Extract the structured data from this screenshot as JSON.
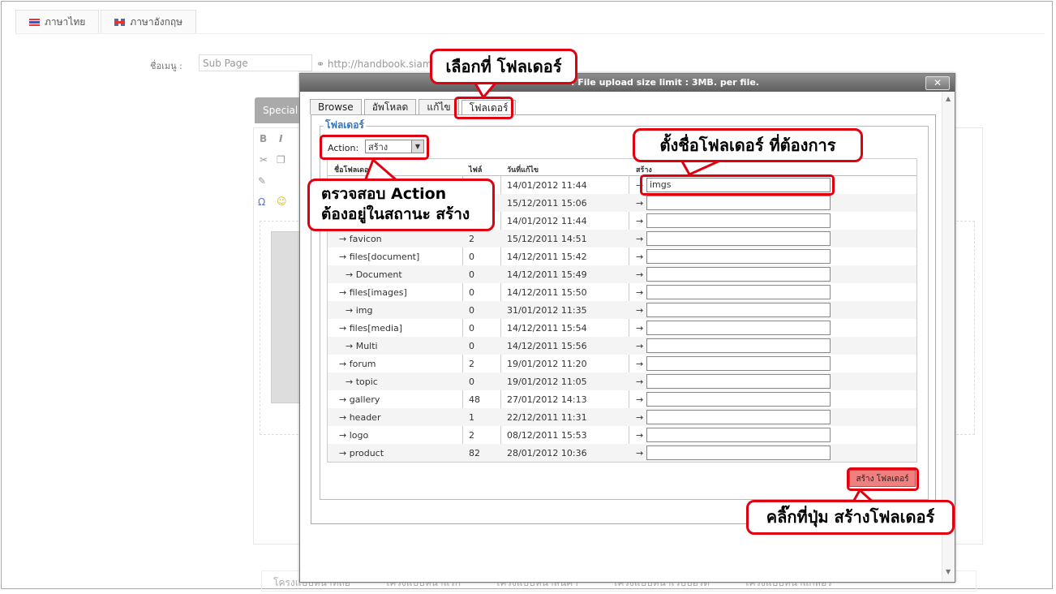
{
  "background": {
    "lang_tabs": [
      {
        "label": "ภาษาไทย",
        "icon": "thai-flag-icon"
      },
      {
        "label": "ภาษาอังกฤษ",
        "icon": "uk-flag-icon"
      }
    ],
    "menu_label": "ชื่อเมนู :",
    "menu_value": "Sub Page",
    "url_text": "http://handbook.siam",
    "special_tab": "Special",
    "bottom_tabs": [
      "โครงแบบหน้าที่ถือ",
      "โครงแบบหน้าแรก",
      "โครงแบบหน้าสินค้า",
      "โครงแบบหน้าเว็บบอร์ด",
      "โครงแบบหน้าแกลอรี่"
    ]
  },
  "dialog": {
    "title": ": File upload size limit : 3MB. per file.",
    "close_label": "✕",
    "tabs": [
      {
        "label": "Browse",
        "active": false
      },
      {
        "label": "อัพโหลด",
        "active": false
      },
      {
        "label": "แก้ไข",
        "active": false
      },
      {
        "label": "โฟลเดอร์",
        "active": true
      }
    ],
    "legend": "โฟลเดอร์",
    "action_label": "Action:",
    "action_value": "สร้าง",
    "columns": {
      "name": "ชื่อโฟลเดอร์",
      "files": "ไฟล์",
      "date": "วันที่แก้ไข",
      "create": "สร้าง"
    },
    "rows": [
      {
        "name": "",
        "files": "",
        "date": "14/01/2012 11:44",
        "input": "imgs"
      },
      {
        "name": "",
        "files": "",
        "date": "15/12/2011 15:06",
        "input": ""
      },
      {
        "name": "",
        "files": "",
        "date": "14/01/2012 11:44",
        "input": ""
      },
      {
        "name": "→ favicon",
        "files": "2",
        "date": "15/12/2011 14:51",
        "input": ""
      },
      {
        "name": "→ files[document]",
        "files": "0",
        "date": "14/12/2011 15:42",
        "input": ""
      },
      {
        "name": "→ Document",
        "files": "0",
        "date": "14/12/2011 15:49",
        "input": "",
        "indent": true
      },
      {
        "name": "→ files[images]",
        "files": "0",
        "date": "14/12/2011 15:50",
        "input": ""
      },
      {
        "name": "→ img",
        "files": "0",
        "date": "31/01/2012 11:35",
        "input": "",
        "indent": true
      },
      {
        "name": "→ files[media]",
        "files": "0",
        "date": "14/12/2011 15:54",
        "input": ""
      },
      {
        "name": "→ Multi",
        "files": "0",
        "date": "14/12/2011 15:56",
        "input": "",
        "indent": true
      },
      {
        "name": "→ forum",
        "files": "2",
        "date": "19/01/2012 11:20",
        "input": ""
      },
      {
        "name": "→ topic",
        "files": "0",
        "date": "19/01/2012 11:05",
        "input": "",
        "indent": true
      },
      {
        "name": "→ gallery",
        "files": "48",
        "date": "27/01/2012 14:13",
        "input": ""
      },
      {
        "name": "→ header",
        "files": "1",
        "date": "22/12/2011 11:31",
        "input": ""
      },
      {
        "name": "→ logo",
        "files": "2",
        "date": "08/12/2011 15:53",
        "input": ""
      },
      {
        "name": "→ product",
        "files": "82",
        "date": "28/01/2012 10:36",
        "input": ""
      }
    ],
    "row_arrow": "→",
    "create_button": "สร้าง โฟลเดอร์"
  },
  "callouts": {
    "select_folder_tab": "เลือกที่ โฟลเดอร์",
    "name_folder": "ตั้งชื่อโฟลเดอร์ ที่ต้องการ",
    "check_action_1": "ตรวจสอบ Action",
    "check_action_2": "ต้องอยู่ในสถานะ สร้าง",
    "click_create": "คลิ๊กที่ปุ่ม สร้างโฟลเดอร์"
  },
  "colors": {
    "callout_border": "#e00010",
    "create_button_bg": "#f08080",
    "legend": "#3377bb"
  }
}
